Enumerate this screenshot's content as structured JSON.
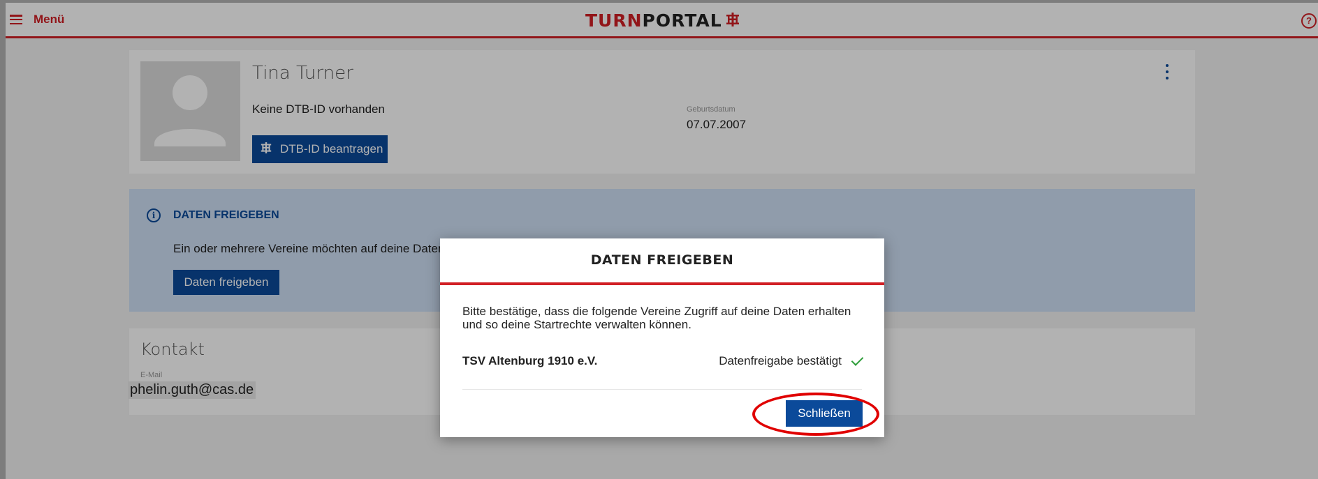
{
  "header": {
    "menu_label": "Menü",
    "logo_part1": "TURN",
    "logo_part2": "PORTAL",
    "help_glyph": "?",
    "accent_color": "#d11f25"
  },
  "profile": {
    "name": "Tina Turner",
    "no_id_text": "Keine DTB-ID vorhanden",
    "dtb_button_label": "DTB-ID beantragen",
    "dob_label": "Geburtsdatum",
    "dob_value": "07.07.2007"
  },
  "info_panel": {
    "icon": "i",
    "title": "DATEN FREIGEBEN",
    "text": "Ein oder mehrere Vereine möchten auf deine Daten",
    "button_label": "Daten freigeben"
  },
  "contact": {
    "title": "Kontakt",
    "email_label": "E-Mail",
    "email_value": "phelin.guth@cas.de"
  },
  "modal": {
    "title": "DATEN FREIGEBEN",
    "text": "Bitte bestätige, dass die folgende Vereine Zugriff auf deine Daten erhalten und so deine Startrechte verwalten können.",
    "club_name": "TSV Altenburg 1910 e.V.",
    "status_text": "Datenfreigabe bestätigt",
    "close_label": "Schließen",
    "primary_color": "#0b4a9a",
    "success_color": "#2e9e3a"
  },
  "icons": [
    "hamburger-menu-icon",
    "turnportal-logo-mark",
    "help-icon",
    "avatar-placeholder-icon",
    "dtb-logo-icon",
    "kebab-menu-icon",
    "info-icon",
    "checkmark-icon"
  ]
}
